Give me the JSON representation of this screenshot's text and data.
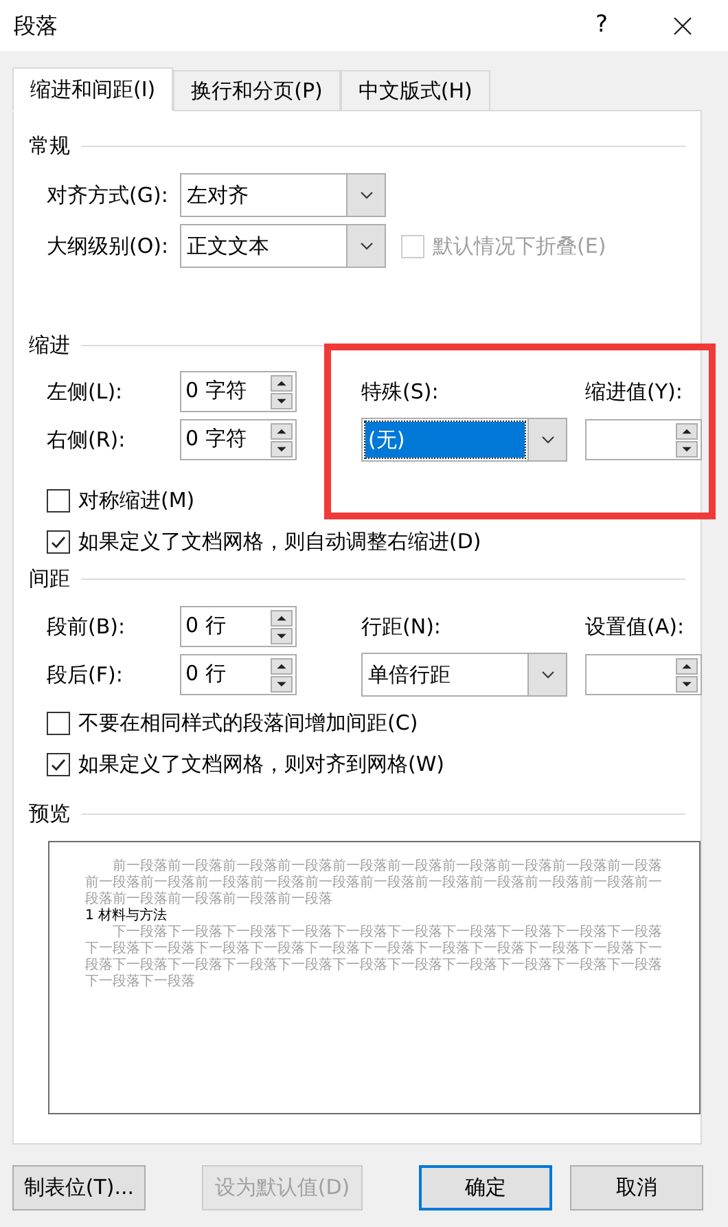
{
  "window": {
    "title": "段落",
    "help": "?"
  },
  "tabs": [
    {
      "label": "缩进和间距(I)",
      "selected": true
    },
    {
      "label": "换行和分页(P)",
      "selected": false
    },
    {
      "label": "中文版式(H)",
      "selected": false
    }
  ],
  "general": {
    "heading": "常规",
    "alignment": {
      "label": "对齐方式(G):",
      "value": "左对齐",
      "focused": false
    },
    "outline_level": {
      "label": "大纲级别(O):",
      "value": "正文文本",
      "focused": false
    },
    "collapse": {
      "label": "默认情况下折叠(E)",
      "checked": false,
      "disabled": true
    }
  },
  "indent": {
    "heading": "缩进",
    "left": {
      "label": "左侧(L):",
      "value": "0 字符"
    },
    "right": {
      "label": "右侧(R):",
      "value": "0 字符"
    },
    "special": {
      "label": "特殊(S):",
      "value": "(无)",
      "focused": true
    },
    "by": {
      "label": "缩进值(Y):"
    },
    "mirror": {
      "label": "对称缩进(M)",
      "checked": false,
      "disabled": false
    },
    "auto_adjust": {
      "label": "如果定义了文档网格，则自动调整右缩进(D)",
      "checked": true,
      "disabled": false
    }
  },
  "spacing": {
    "heading": "间距",
    "before": {
      "label": "段前(B):",
      "value": "0 行"
    },
    "after": {
      "label": "段后(F):",
      "value": "0 行"
    },
    "line_spacing": {
      "label": "行距(N):",
      "value": "单倍行距",
      "focused": false
    },
    "at": {
      "label": "设置值(A):"
    },
    "no_space_same_style": {
      "label": "不要在相同样式的段落间增加间距(C)",
      "checked": false,
      "disabled": false
    },
    "snap_to_grid": {
      "label": "如果定义了文档网格，则对齐到网格(W)",
      "checked": true,
      "disabled": false
    }
  },
  "preview": {
    "heading": "预览",
    "previous": "前一段落前一段落前一段落前一段落前一段落前一段落前一段落前一段落前一段落前一段落前一段落前一段落前一段落前一段落前一段落前一段落前一段落前一段落前一段落前一段落前一段落前一段落前一段落前一段落前一段落",
    "current": "1 材料与方法",
    "next": "下一段落下一段落下一段落下一段落下一段落下一段落下一段落下一段落下一段落下一段落下一段落下一段落下一段落下一段落下一段落下一段落下一段落下一段落下一段落下一段落下一段落下一段落下一段落下一段落下一段落下一段落下一段落下一段落下一段落下一段落下一段落下一段落下一段落"
  },
  "buttons": [
    {
      "label": "制表位(T)...",
      "disabled": false,
      "default": false
    },
    {
      "label": "设为默认值(D)",
      "disabled": true,
      "default": false
    },
    {
      "label": "确定",
      "disabled": false,
      "default": true
    },
    {
      "label": "取消",
      "disabled": false,
      "default": false
    }
  ],
  "annotation": {
    "kind": "rectangle"
  }
}
